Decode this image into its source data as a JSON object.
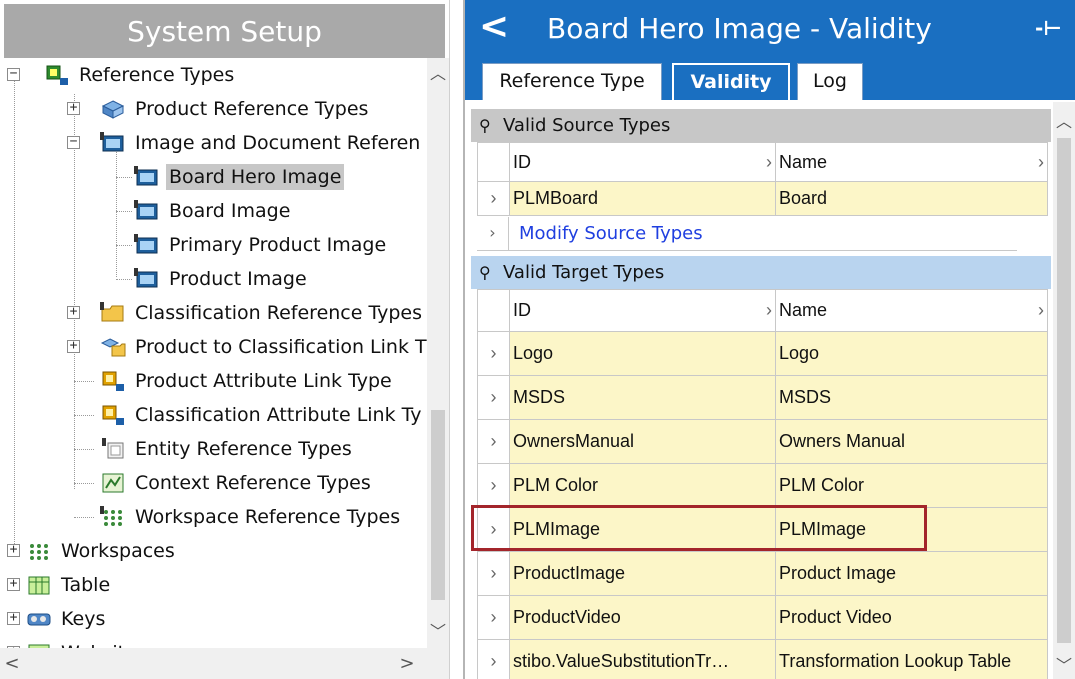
{
  "left": {
    "title": "System Setup",
    "tree": [
      {
        "label": "Reference Types",
        "expander": "−",
        "icon": "reference-types-icon"
      },
      {
        "label": "Product Reference Types",
        "expander": "+",
        "icon": "product-reference-icon"
      },
      {
        "label": "Image and Document Referen",
        "expander": "−",
        "icon": "image-folder-icon"
      },
      {
        "label": "Board Hero Image",
        "icon": "image-reference-icon",
        "selected": true
      },
      {
        "label": "Board Image",
        "icon": "image-reference-icon"
      },
      {
        "label": "Primary Product Image",
        "icon": "image-reference-icon"
      },
      {
        "label": "Product Image",
        "icon": "image-reference-icon"
      },
      {
        "label": "Classification Reference Types",
        "expander": "+",
        "icon": "classification-folder-icon"
      },
      {
        "label": "Product to Classification Link T",
        "expander": "+",
        "icon": "link-type-icon"
      },
      {
        "label": "Product Attribute Link Type",
        "icon": "attribute-link-icon"
      },
      {
        "label": "Classification Attribute Link Ty",
        "icon": "attribute-link-icon"
      },
      {
        "label": "Entity Reference Types",
        "icon": "entity-reference-icon"
      },
      {
        "label": "Context Reference Types",
        "icon": "context-reference-icon"
      },
      {
        "label": "Workspace Reference Types",
        "icon": "workspace-reference-icon"
      },
      {
        "label": "Workspaces",
        "expander": "+",
        "icon": "workspaces-icon"
      },
      {
        "label": "Table",
        "expander": "+",
        "icon": "table-icon"
      },
      {
        "label": "Keys",
        "expander": "+",
        "icon": "keys-icon"
      },
      {
        "label": "Websites",
        "expander": "+",
        "icon": "websites-icon"
      }
    ]
  },
  "right": {
    "title": "Board Hero Image - Validity",
    "tabs": [
      {
        "label": "Reference Type",
        "active": false
      },
      {
        "label": "Validity",
        "active": true
      },
      {
        "label": "Log",
        "active": false
      }
    ],
    "source": {
      "heading": "Valid Source Types",
      "columns": [
        "ID",
        "Name"
      ],
      "rows": [
        [
          "PLMBoard",
          "Board"
        ]
      ],
      "modify_link": "Modify Source Types"
    },
    "target": {
      "heading": "Valid Target Types",
      "columns": [
        "ID",
        "Name"
      ],
      "rows": [
        [
          "Logo",
          "Logo"
        ],
        [
          "MSDS",
          "MSDS"
        ],
        [
          "OwnersManual",
          "Owners Manual"
        ],
        [
          "PLM Color",
          "PLM Color"
        ],
        [
          "PLMImage",
          "PLMImage"
        ],
        [
          "ProductImage",
          "Product Image"
        ],
        [
          "ProductVideo",
          "Product Video"
        ],
        [
          "stibo.ValueSubstitutionTr…",
          "Transformation Lookup Table"
        ]
      ]
    },
    "highlight_color": "#a3252b",
    "header_color": "#1a6fc1"
  }
}
